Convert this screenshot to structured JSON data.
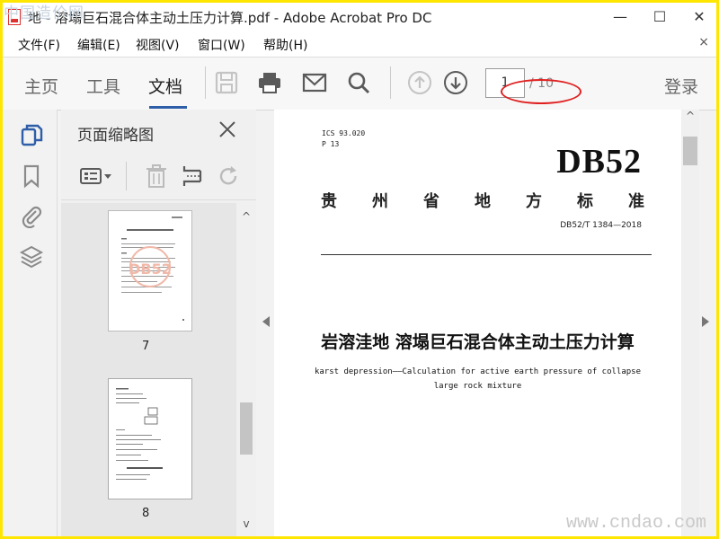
{
  "window": {
    "title": "地 - 溶塌巨石混合体主动土压力计算.pdf - Adobe Acrobat Pro DC",
    "minimize": "—",
    "maximize": "☐",
    "close": "✕"
  },
  "watermark_top": "中国造价网",
  "watermark_bottom": "www.cndao.com",
  "menu": {
    "items": [
      "文件(F)",
      "编辑(E)",
      "视图(V)",
      "窗口(W)",
      "帮助(H)"
    ],
    "close": "×"
  },
  "toolbar": {
    "tabs": [
      "主页",
      "工具",
      "文档"
    ],
    "active_tab": "文档",
    "icons": [
      "save-icon",
      "print-icon",
      "email-icon",
      "search-icon",
      "page-up-icon",
      "page-down-icon"
    ],
    "page_current": "1",
    "page_total": "/ 10",
    "login": "登录"
  },
  "sidebar_rail": {
    "icons": [
      "page-thumbnails-icon",
      "bookmark-icon",
      "attachment-icon",
      "layers-icon"
    ]
  },
  "thumbnail_panel": {
    "title": "页面缩略图",
    "tools": [
      "thumbnail-options-icon",
      "trash-icon",
      "crop-icon",
      "rotate-icon"
    ],
    "pages": [
      {
        "label": "7"
      },
      {
        "label": "8"
      }
    ]
  },
  "document": {
    "ics": "ICS 93.020",
    "p": "P 13",
    "db": "DB52",
    "standard_chars": [
      "贵",
      "州",
      "省",
      "地",
      "方",
      "标",
      "准"
    ],
    "code": "DB52/T 1384—2018",
    "title_cn": "岩溶洼地 溶塌巨石混合体主动土压力计算",
    "title_en_line1": "karst depression——Calculation for active earth pressure of collapse",
    "title_en_line2": "large rock mixture"
  },
  "colors": {
    "accent": "#2e5ea8",
    "annotation": "#e02020",
    "frame": "#ffe600"
  }
}
